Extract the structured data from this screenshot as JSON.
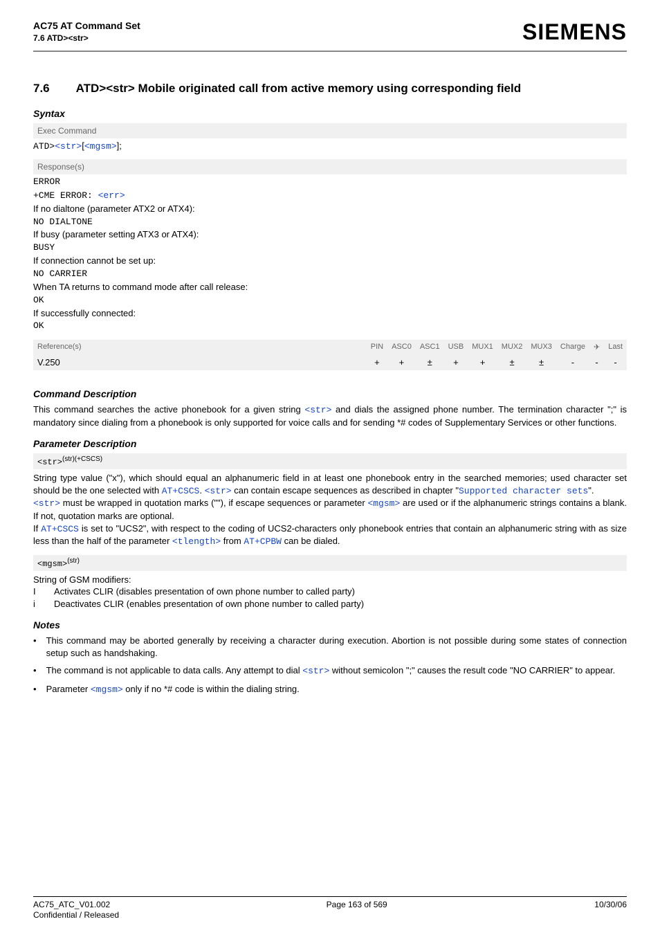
{
  "header": {
    "doc_title": "AC75 AT Command Set",
    "doc_sub": "7.6 ATD><str>",
    "brand": "SIEMENS"
  },
  "section": {
    "num": "7.6",
    "title": "ATD><str>   Mobile originated call from active memory using corresponding field"
  },
  "syntax": {
    "heading": "Syntax",
    "exec_label": "Exec Command",
    "exec_prefix": "ATD>",
    "exec_p1": "<str>",
    "exec_br_open": "[",
    "exec_p2": "<mgsm>",
    "exec_br_close": "]",
    "exec_semicolon": ";",
    "resp_label": "Response(s)",
    "r_error": "ERROR",
    "r_cme_prefix": "+CME ERROR: ",
    "r_cme_err": "<err>",
    "r_nodial_cond": "If no dialtone (parameter ATX2 or ATX4):",
    "r_nodial": "NO DIALTONE",
    "r_busy_cond": "If busy (parameter setting ATX3 or ATX4):",
    "r_busy": "BUSY",
    "r_noconn_cond": "If connection cannot be set up:",
    "r_nocarrier": "NO CARRIER",
    "r_return_cond": "When TA returns to command mode after call release:",
    "r_ok1": "OK",
    "r_success_cond": "If successfully connected:",
    "r_ok2": "OK"
  },
  "ref": {
    "label": "Reference(s)",
    "h_pin": "PIN",
    "h_asc0": "ASC0",
    "h_asc1": "ASC1",
    "h_usb": "USB",
    "h_mux1": "MUX1",
    "h_mux2": "MUX2",
    "h_mux3": "MUX3",
    "h_charge": "Charge",
    "h_air": "✈",
    "h_last": "Last",
    "row_label": "V.250",
    "v_pin": "+",
    "v_asc0": "+",
    "v_asc1": "±",
    "v_usb": "+",
    "v_mux1": "+",
    "v_mux2": "±",
    "v_mux3": "±",
    "v_charge": "-",
    "v_air": "-",
    "v_last": "-"
  },
  "cmd_desc": {
    "heading": "Command Description",
    "p1a": "This command searches the active phonebook for a given string ",
    "p1b": "<str>",
    "p1c": " and dials the assigned phone number. The termination character \";\" is mandatory since dialing from a phonebook is only supported for voice calls and for sending *# codes of Supplementary Services or other functions."
  },
  "param": {
    "heading": "Parameter Description",
    "p1_name": "<str>",
    "p1_sup": "(str)(+CSCS)",
    "p1_t1": "String type value (\"x\"), which should equal an alphanumeric field in at least one phonebook entry in the searched memories; used character set should be the one selected with ",
    "p1_cscs": "AT+CSCS",
    "p1_t2": ". ",
    "p1_str1": "<str>",
    "p1_t3": " can contain escape sequences as described in chapter \"",
    "p1_link": "Supported character sets",
    "p1_t4": "\".",
    "p1_t5a": "<str>",
    "p1_t5b": " must be wrapped in quotation marks (\"\"), if escape sequences or parameter ",
    "p1_mgsm": "<mgsm>",
    "p1_t5c": " are used or if the alphanumeric strings contains a blank. If not, quotation marks are optional.",
    "p1_t6a": "If ",
    "p1_cscs2": "AT+CSCS",
    "p1_t6b": " is set to \"UCS2\", with respect to the coding of UCS2-characters only phonebook entries that contain an alphanumeric string with as size less than the half of the parameter ",
    "p1_tlen": "<tlength>",
    "p1_t6c": " from ",
    "p1_cpbw": "AT+CPBW",
    "p1_t6d": " can be dialed.",
    "p2_name": "<mgsm>",
    "p2_sup": "(str)",
    "p2_intro": "String of GSM modifiers:",
    "p2_I_k": "I",
    "p2_I_v": "Activates CLIR (disables presentation of own phone number to called party)",
    "p2_i_k": "i",
    "p2_i_v": "Deactivates CLIR (enables presentation of own phone number to called party)"
  },
  "notes": {
    "heading": "Notes",
    "n1": "This command may be aborted generally by receiving a character during execution. Abortion is not possible during some states of connection setup such as handshaking.",
    "n2a": "The command is not applicable to data calls. Any attempt to dial ",
    "n2b": "<str>",
    "n2c": " without semicolon \";\" causes the result code \"NO CARRIER\" to appear.",
    "n3a": "Parameter ",
    "n3b": "<mgsm>",
    "n3c": " only if no *# code is within the dialing string."
  },
  "footer": {
    "left1": "AC75_ATC_V01.002",
    "left2": "Confidential / Released",
    "center": "Page 163 of 569",
    "right": "10/30/06"
  }
}
